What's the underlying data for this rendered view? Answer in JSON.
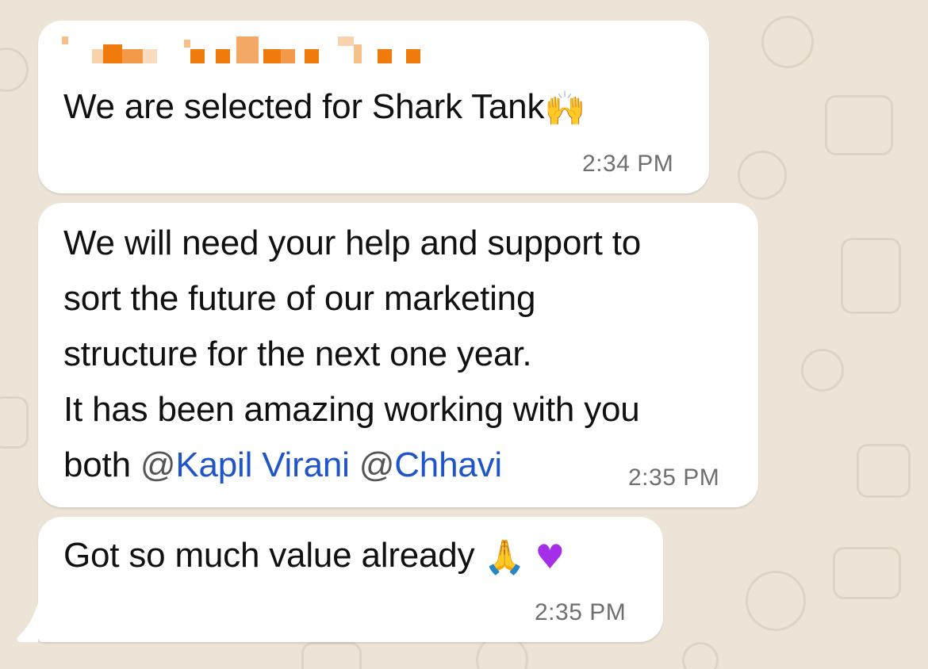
{
  "chat": {
    "messages": [
      {
        "sender_name_redacted": true,
        "text": "We are selected for Shark Tank",
        "emoji": "raising-hands",
        "time": "2:34 PM"
      },
      {
        "lines": [
          "We will need your help and support to",
          "sort the future of our marketing",
          "structure for the next one year.",
          "It has been amazing working with you"
        ],
        "last_line_prefix": "both ",
        "mentions": [
          "Kapil Virani",
          "Chhavi"
        ],
        "time": "2:35 PM"
      },
      {
        "text": "Got so much value already",
        "emojis": [
          "folded-hands",
          "purple-heart"
        ],
        "time": "2:35 PM"
      }
    ]
  },
  "colors": {
    "wallpaper": "#ece4d6",
    "bubble": "#ffffff",
    "mention": "#1f55c9",
    "timestamp": "#6f6f6f",
    "sender_redaction": "#f07a0c"
  }
}
